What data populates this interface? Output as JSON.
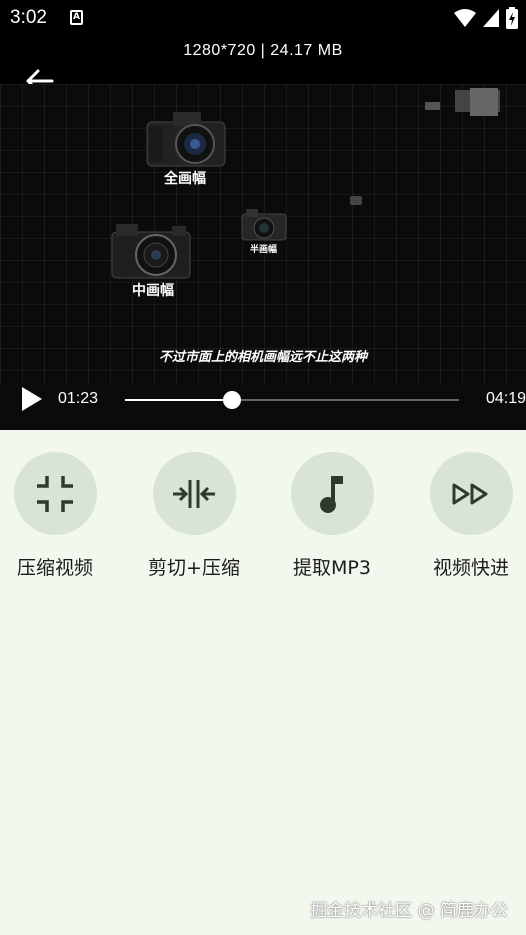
{
  "status_bar": {
    "time": "3:02",
    "icons": [
      "notification-a-icon",
      "wifi-icon",
      "signal-icon",
      "battery-icon"
    ]
  },
  "header": {
    "video_info": "1280*720 | 24.17 MB"
  },
  "video": {
    "labels": {
      "full_frame": "全画幅",
      "medium_format": "中画幅",
      "half_frame": "半画幅"
    },
    "subtitle": "不过市面上的相机画幅远不止这两种"
  },
  "player": {
    "current_time": "01:23",
    "total_time": "04:19",
    "progress": 0.32
  },
  "tools": [
    {
      "label": "压缩视频",
      "icon": "compress-icon"
    },
    {
      "label": "剪切+压缩",
      "icon": "cut-compress-icon"
    },
    {
      "label": "提取MP3",
      "icon": "music-note-icon"
    },
    {
      "label": "视频快进",
      "icon": "fast-forward-icon"
    }
  ],
  "watermark": "掘金技术社区 @ 简鹿办公",
  "colors": {
    "background": "#f2f8ee",
    "tool_circle": "#d9e5d4",
    "icon": "#2f3a2f"
  }
}
